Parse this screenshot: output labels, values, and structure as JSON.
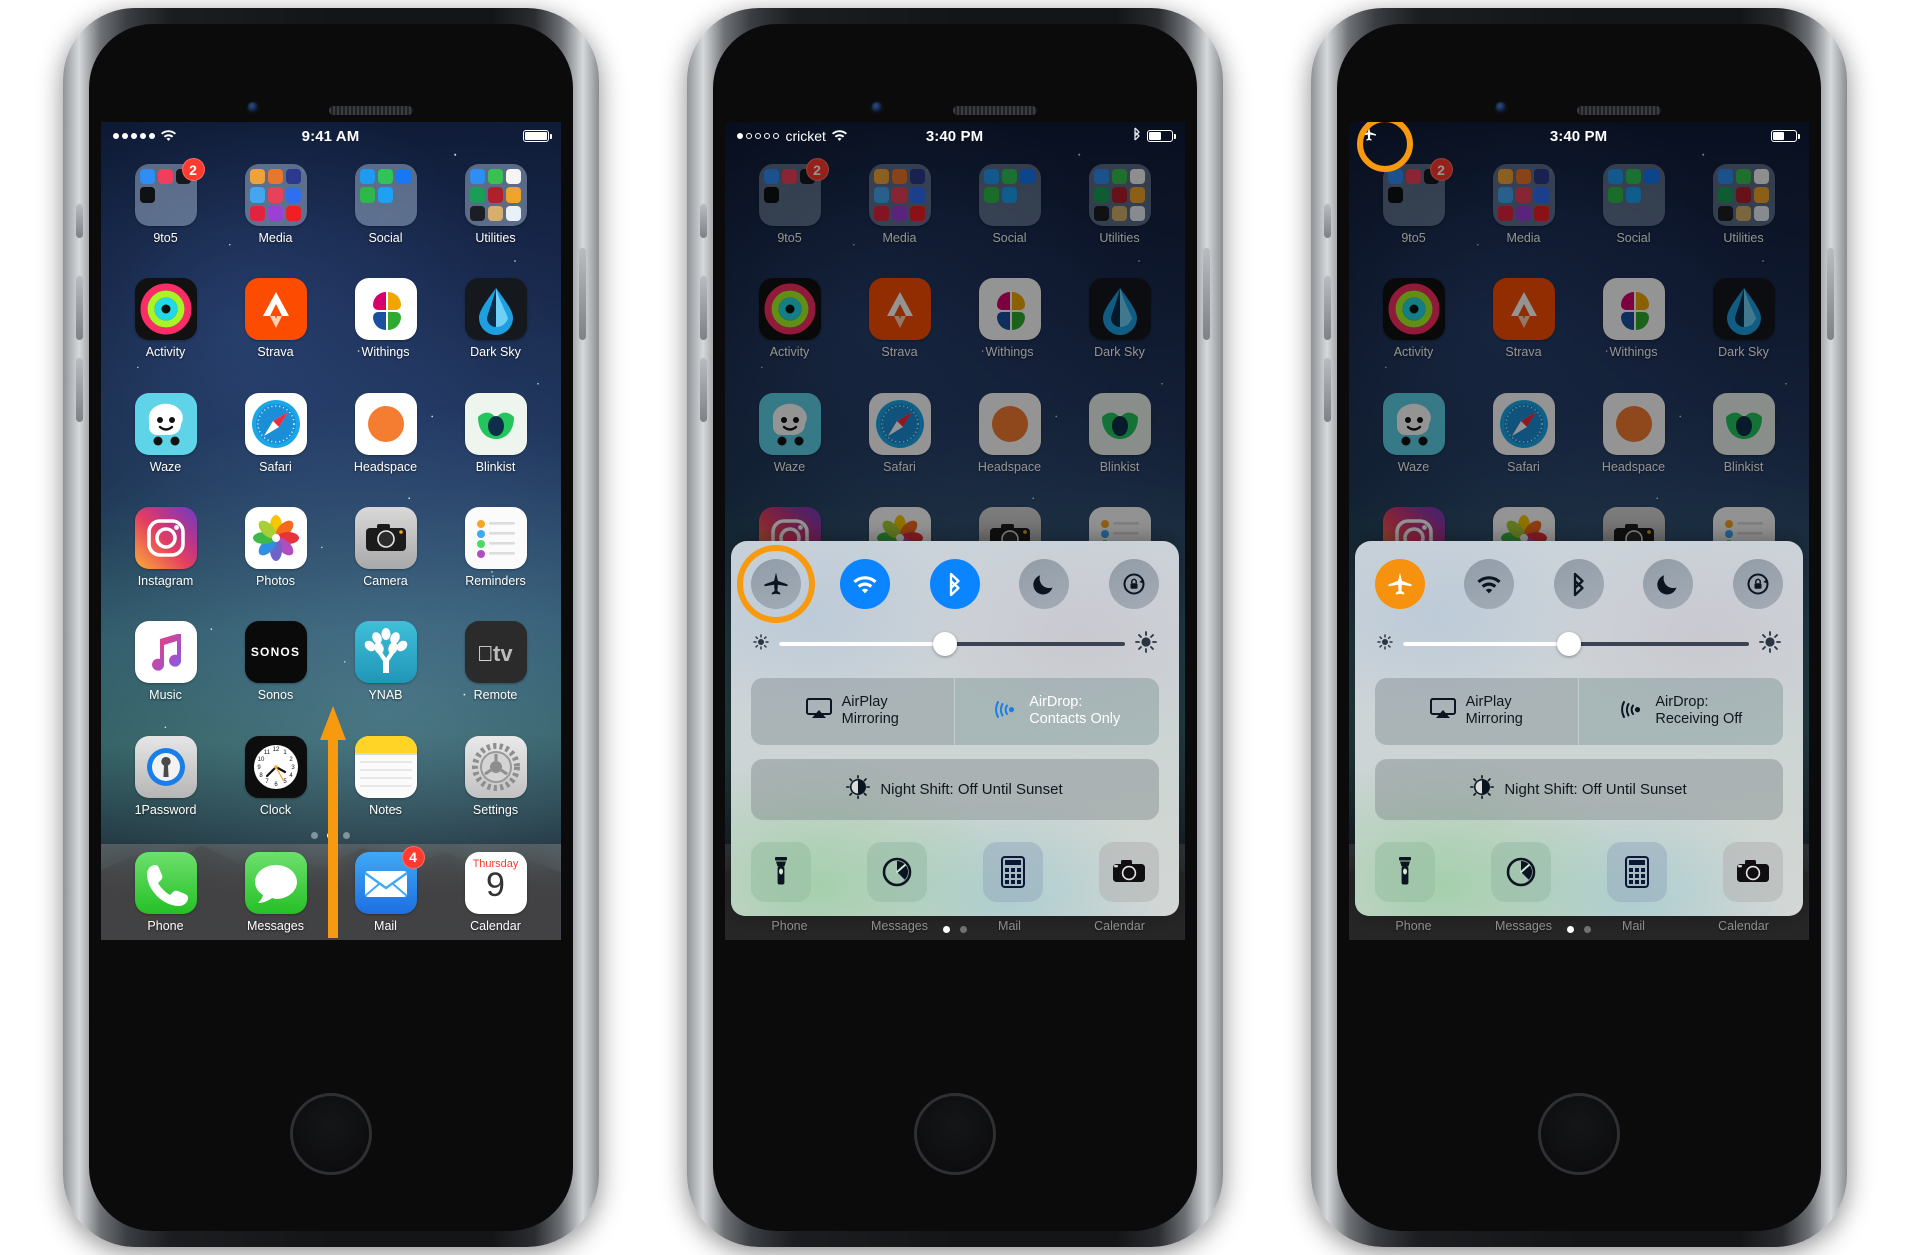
{
  "phones": [
    {
      "id": "phone-home-screen",
      "statusbar": {
        "signal_dots_filled": 5,
        "signal_dots_total": 5,
        "carrier": "",
        "wifi": true,
        "time": "9:41 AM",
        "battery_pct": 100,
        "bluetooth": false,
        "airplane": false
      },
      "home": {
        "rows": [
          [
            {
              "name": "9to5",
              "type": "folder",
              "badge": "2",
              "mini": [
                "#2f8ef4",
                "#ef3f5a",
                "#15181c",
                "#0f1114",
                "",
                "",
                "",
                "",
                ""
              ]
            },
            {
              "name": "Media",
              "type": "folder",
              "badge": "",
              "mini": [
                "#f0a23a",
                "#e8762c",
                "#2b3a8c",
                "#45a6f0",
                "#e8415a",
                "#2e6ef0",
                "#e0243f",
                "#9c3fd4",
                "#f01f24"
              ]
            },
            {
              "name": "Social",
              "type": "folder",
              "badge": "",
              "mini": [
                "#1e9bf0",
                "#2fc35a",
                "#1877f2",
                "#2fb84a",
                "#1da1f2",
                "",
                "",
                "",
                ""
              ]
            },
            {
              "name": "Utilities",
              "type": "folder",
              "badge": "",
              "mini": [
                "#2f8ef4",
                "#3ac050",
                "#f5f5f5",
                "#1a9e57",
                "#b21f2c",
                "#f0a42a",
                "#1b1e22",
                "#d6b06a",
                "#e8f0f8"
              ]
            }
          ],
          [
            {
              "name": "Activity",
              "type": "app",
              "icon": "activity-rings"
            },
            {
              "name": "Strava",
              "type": "app",
              "icon": "strava-chevron"
            },
            {
              "name": "Withings",
              "type": "app",
              "icon": "withings-petals"
            },
            {
              "name": "Dark Sky",
              "type": "app",
              "icon": "darksky-drop"
            }
          ],
          [
            {
              "name": "Waze",
              "type": "app",
              "icon": "waze-face"
            },
            {
              "name": "Safari",
              "type": "app",
              "icon": "safari-compass"
            },
            {
              "name": "Headspace",
              "type": "app",
              "icon": "headspace-circle"
            },
            {
              "name": "Blinkist",
              "type": "app",
              "icon": "blinkist-leaf"
            }
          ],
          [
            {
              "name": "Instagram",
              "type": "app",
              "icon": "instagram-camera"
            },
            {
              "name": "Photos",
              "type": "app",
              "icon": "photos-flower"
            },
            {
              "name": "Camera",
              "type": "app",
              "icon": "camera-body"
            },
            {
              "name": "Reminders",
              "type": "app",
              "icon": "reminders-list"
            }
          ],
          [
            {
              "name": "Music",
              "type": "app",
              "icon": "music-note"
            },
            {
              "name": "Sonos",
              "type": "app",
              "icon": "sonos-wordmark",
              "text": "SONOS"
            },
            {
              "name": "YNAB",
              "type": "app",
              "icon": "ynab-tree"
            },
            {
              "name": "Remote",
              "type": "app",
              "icon": "appletv-remote",
              "text": "tv"
            }
          ],
          [
            {
              "name": "1Password",
              "type": "app",
              "icon": "onepassword-keyhole"
            },
            {
              "name": "Clock",
              "type": "app",
              "icon": "clock-face"
            },
            {
              "name": "Notes",
              "type": "app",
              "icon": "notes-pad"
            },
            {
              "name": "Settings",
              "type": "app",
              "icon": "settings-gears"
            }
          ]
        ],
        "page_dots": {
          "count": 3,
          "active_index": 1
        },
        "dock": [
          {
            "name": "Phone",
            "type": "app",
            "icon": "phone-handset",
            "badge": ""
          },
          {
            "name": "Messages",
            "type": "app",
            "icon": "messages-bubble",
            "badge": ""
          },
          {
            "name": "Mail",
            "type": "app",
            "icon": "mail-envelope",
            "badge": "4"
          },
          {
            "name": "Calendar",
            "type": "app",
            "icon": "calendar-date",
            "weekday": "Thursday",
            "day": "9",
            "badge": ""
          }
        ]
      },
      "annotation": {
        "type": "swipe-up-arrow",
        "color": "#f79a10"
      },
      "control_center": null
    },
    {
      "id": "phone-control-center-airplane-off",
      "statusbar": {
        "signal_dots_filled": 1,
        "signal_dots_total": 5,
        "carrier": "cricket",
        "wifi": true,
        "time": "3:40 PM",
        "battery_pct": 55,
        "bluetooth": true,
        "airplane": false
      },
      "control_center": {
        "toggles": [
          {
            "name": "airplane-mode",
            "state": "off",
            "highlighted": true
          },
          {
            "name": "wifi",
            "state": "on",
            "highlighted": false
          },
          {
            "name": "bluetooth",
            "state": "on",
            "highlighted": false
          },
          {
            "name": "do-not-disturb",
            "state": "off",
            "highlighted": false
          },
          {
            "name": "rotation-lock",
            "state": "off",
            "highlighted": false
          }
        ],
        "brightness": {
          "value_pct": 48
        },
        "airplay_label_line1": "AirPlay",
        "airplay_label_line2": "Mirroring",
        "airdrop_label_line1": "AirDrop:",
        "airdrop_label_line2": "Contacts Only",
        "airdrop_active": true,
        "night_shift": "Night Shift: Off Until Sunset",
        "shortcuts": [
          "flashlight",
          "timer",
          "calculator",
          "camera"
        ],
        "page_dots": {
          "count": 2,
          "active_index": 0
        }
      },
      "annotation": null
    },
    {
      "id": "phone-control-center-airplane-on",
      "statusbar": {
        "signal_dots_filled": 0,
        "signal_dots_total": 0,
        "carrier": "",
        "wifi": false,
        "time": "3:40 PM",
        "battery_pct": 52,
        "bluetooth": false,
        "airplane": true,
        "airplane_highlighted": true
      },
      "control_center": {
        "toggles": [
          {
            "name": "airplane-mode",
            "state": "on",
            "highlighted": false
          },
          {
            "name": "wifi",
            "state": "off",
            "highlighted": false
          },
          {
            "name": "bluetooth",
            "state": "off",
            "highlighted": false
          },
          {
            "name": "do-not-disturb",
            "state": "off",
            "highlighted": false
          },
          {
            "name": "rotation-lock",
            "state": "off",
            "highlighted": false
          }
        ],
        "brightness": {
          "value_pct": 48
        },
        "airplay_label_line1": "AirPlay",
        "airplay_label_line2": "Mirroring",
        "airdrop_label_line1": "AirDrop:",
        "airdrop_label_line2": "Receiving Off",
        "airdrop_active": false,
        "night_shift": "Night Shift: Off Until Sunset",
        "shortcuts": [
          "flashlight",
          "timer",
          "calculator",
          "camera"
        ],
        "page_dots": {
          "count": 2,
          "active_index": 0
        }
      },
      "annotation": null
    }
  ],
  "colors": {
    "highlight": "#f79a10",
    "ios_blue": "#0b84ff",
    "ios_orange": "#f6920e",
    "badge_red": "#ff3b30"
  }
}
